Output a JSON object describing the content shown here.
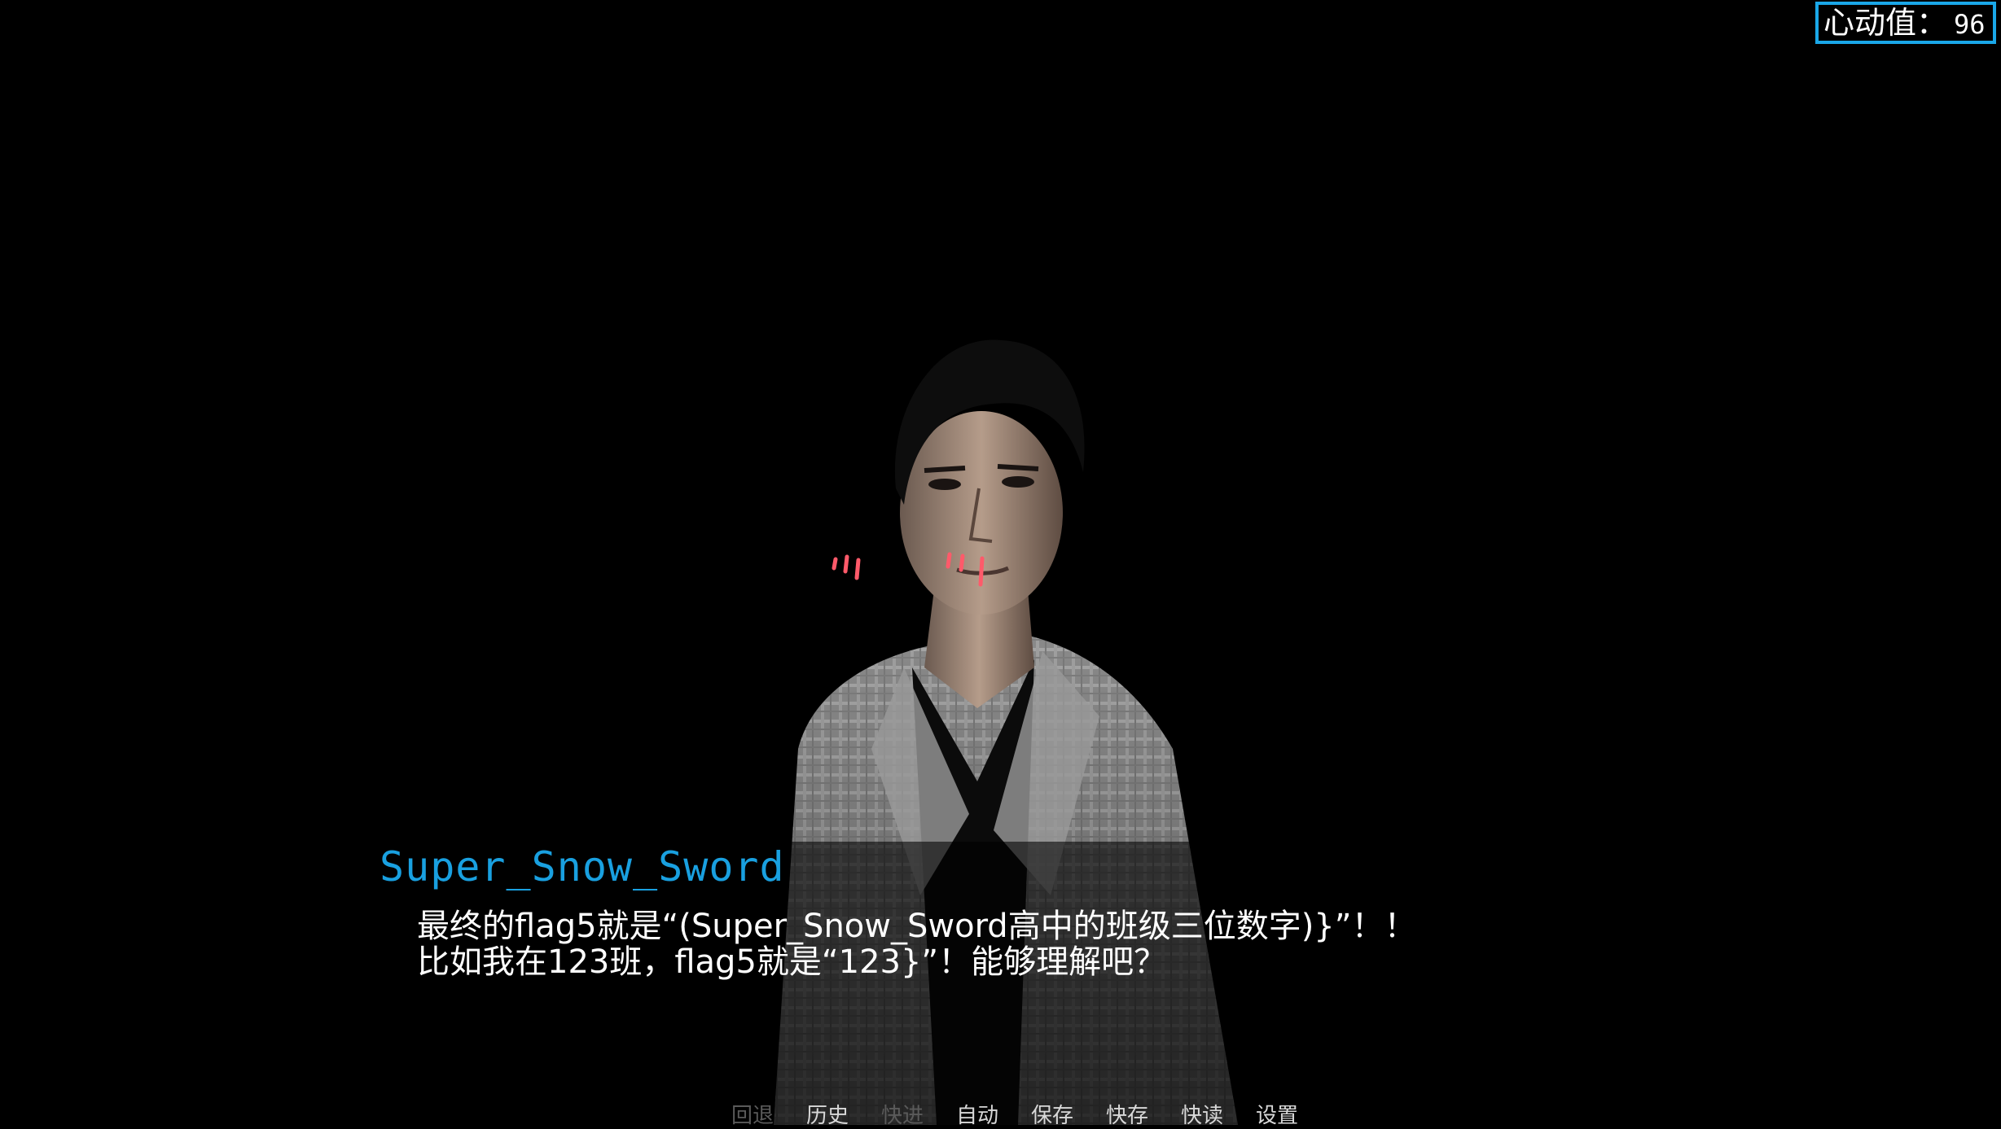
{
  "hud": {
    "affection_label": "心动值：",
    "affection_value": "96"
  },
  "sprite": {
    "icon": "character-portrait"
  },
  "dialogue": {
    "speaker": "Super_Snow_Sword",
    "lines": [
      "最终的flag5就是“(Super_Snow_Sword高中的班级三位数字)}”！！",
      "比如我在123班，flag5就是“123}”！能够理解吧？"
    ]
  },
  "quick_menu": {
    "items": [
      {
        "label": "回退",
        "enabled": false
      },
      {
        "label": "历史",
        "enabled": true
      },
      {
        "label": "快进",
        "enabled": false
      },
      {
        "label": "自动",
        "enabled": true
      },
      {
        "label": "保存",
        "enabled": true
      },
      {
        "label": "快存",
        "enabled": true
      },
      {
        "label": "快读",
        "enabled": true
      },
      {
        "label": "设置",
        "enabled": true
      }
    ]
  },
  "colors": {
    "accent": "#1aa7e8",
    "speaker": "#19a0e0",
    "text": "#ffffff",
    "menu_disabled": "#5a5a5a",
    "blush": "#ff5a6a"
  }
}
